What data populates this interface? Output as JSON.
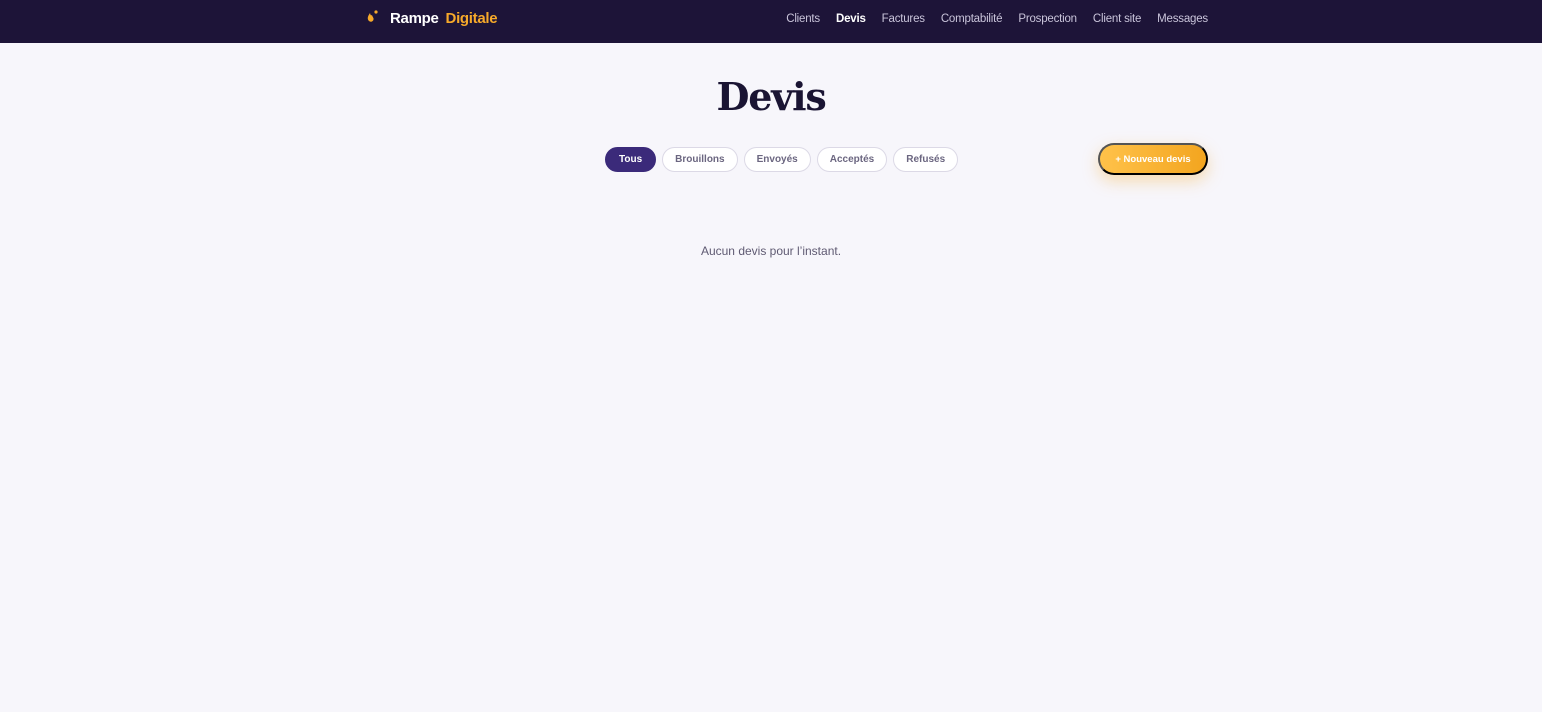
{
  "brand": {
    "name_part1": "Rampe",
    "name_part2": "Digitale",
    "icon": "flame-icon",
    "colors": {
      "primary": "#1d1438",
      "accent": "#f6a92a"
    }
  },
  "nav": {
    "items": [
      {
        "label": "Clients"
      },
      {
        "label": "Devis",
        "active": true
      },
      {
        "label": "Factures"
      },
      {
        "label": "Comptabilité"
      },
      {
        "label": "Prospection"
      },
      {
        "label": "Client site"
      },
      {
        "label": "Messages"
      }
    ]
  },
  "page": {
    "title": "Devis",
    "empty_message": "Aucun devis pour l’instant."
  },
  "filters": {
    "items": [
      {
        "label": "Tous",
        "active": true
      },
      {
        "label": "Brouillons"
      },
      {
        "label": "Envoyés"
      },
      {
        "label": "Acceptés"
      },
      {
        "label": "Refusés"
      }
    ]
  },
  "actions": {
    "new_quote_label": "+ Nouveau devis"
  }
}
